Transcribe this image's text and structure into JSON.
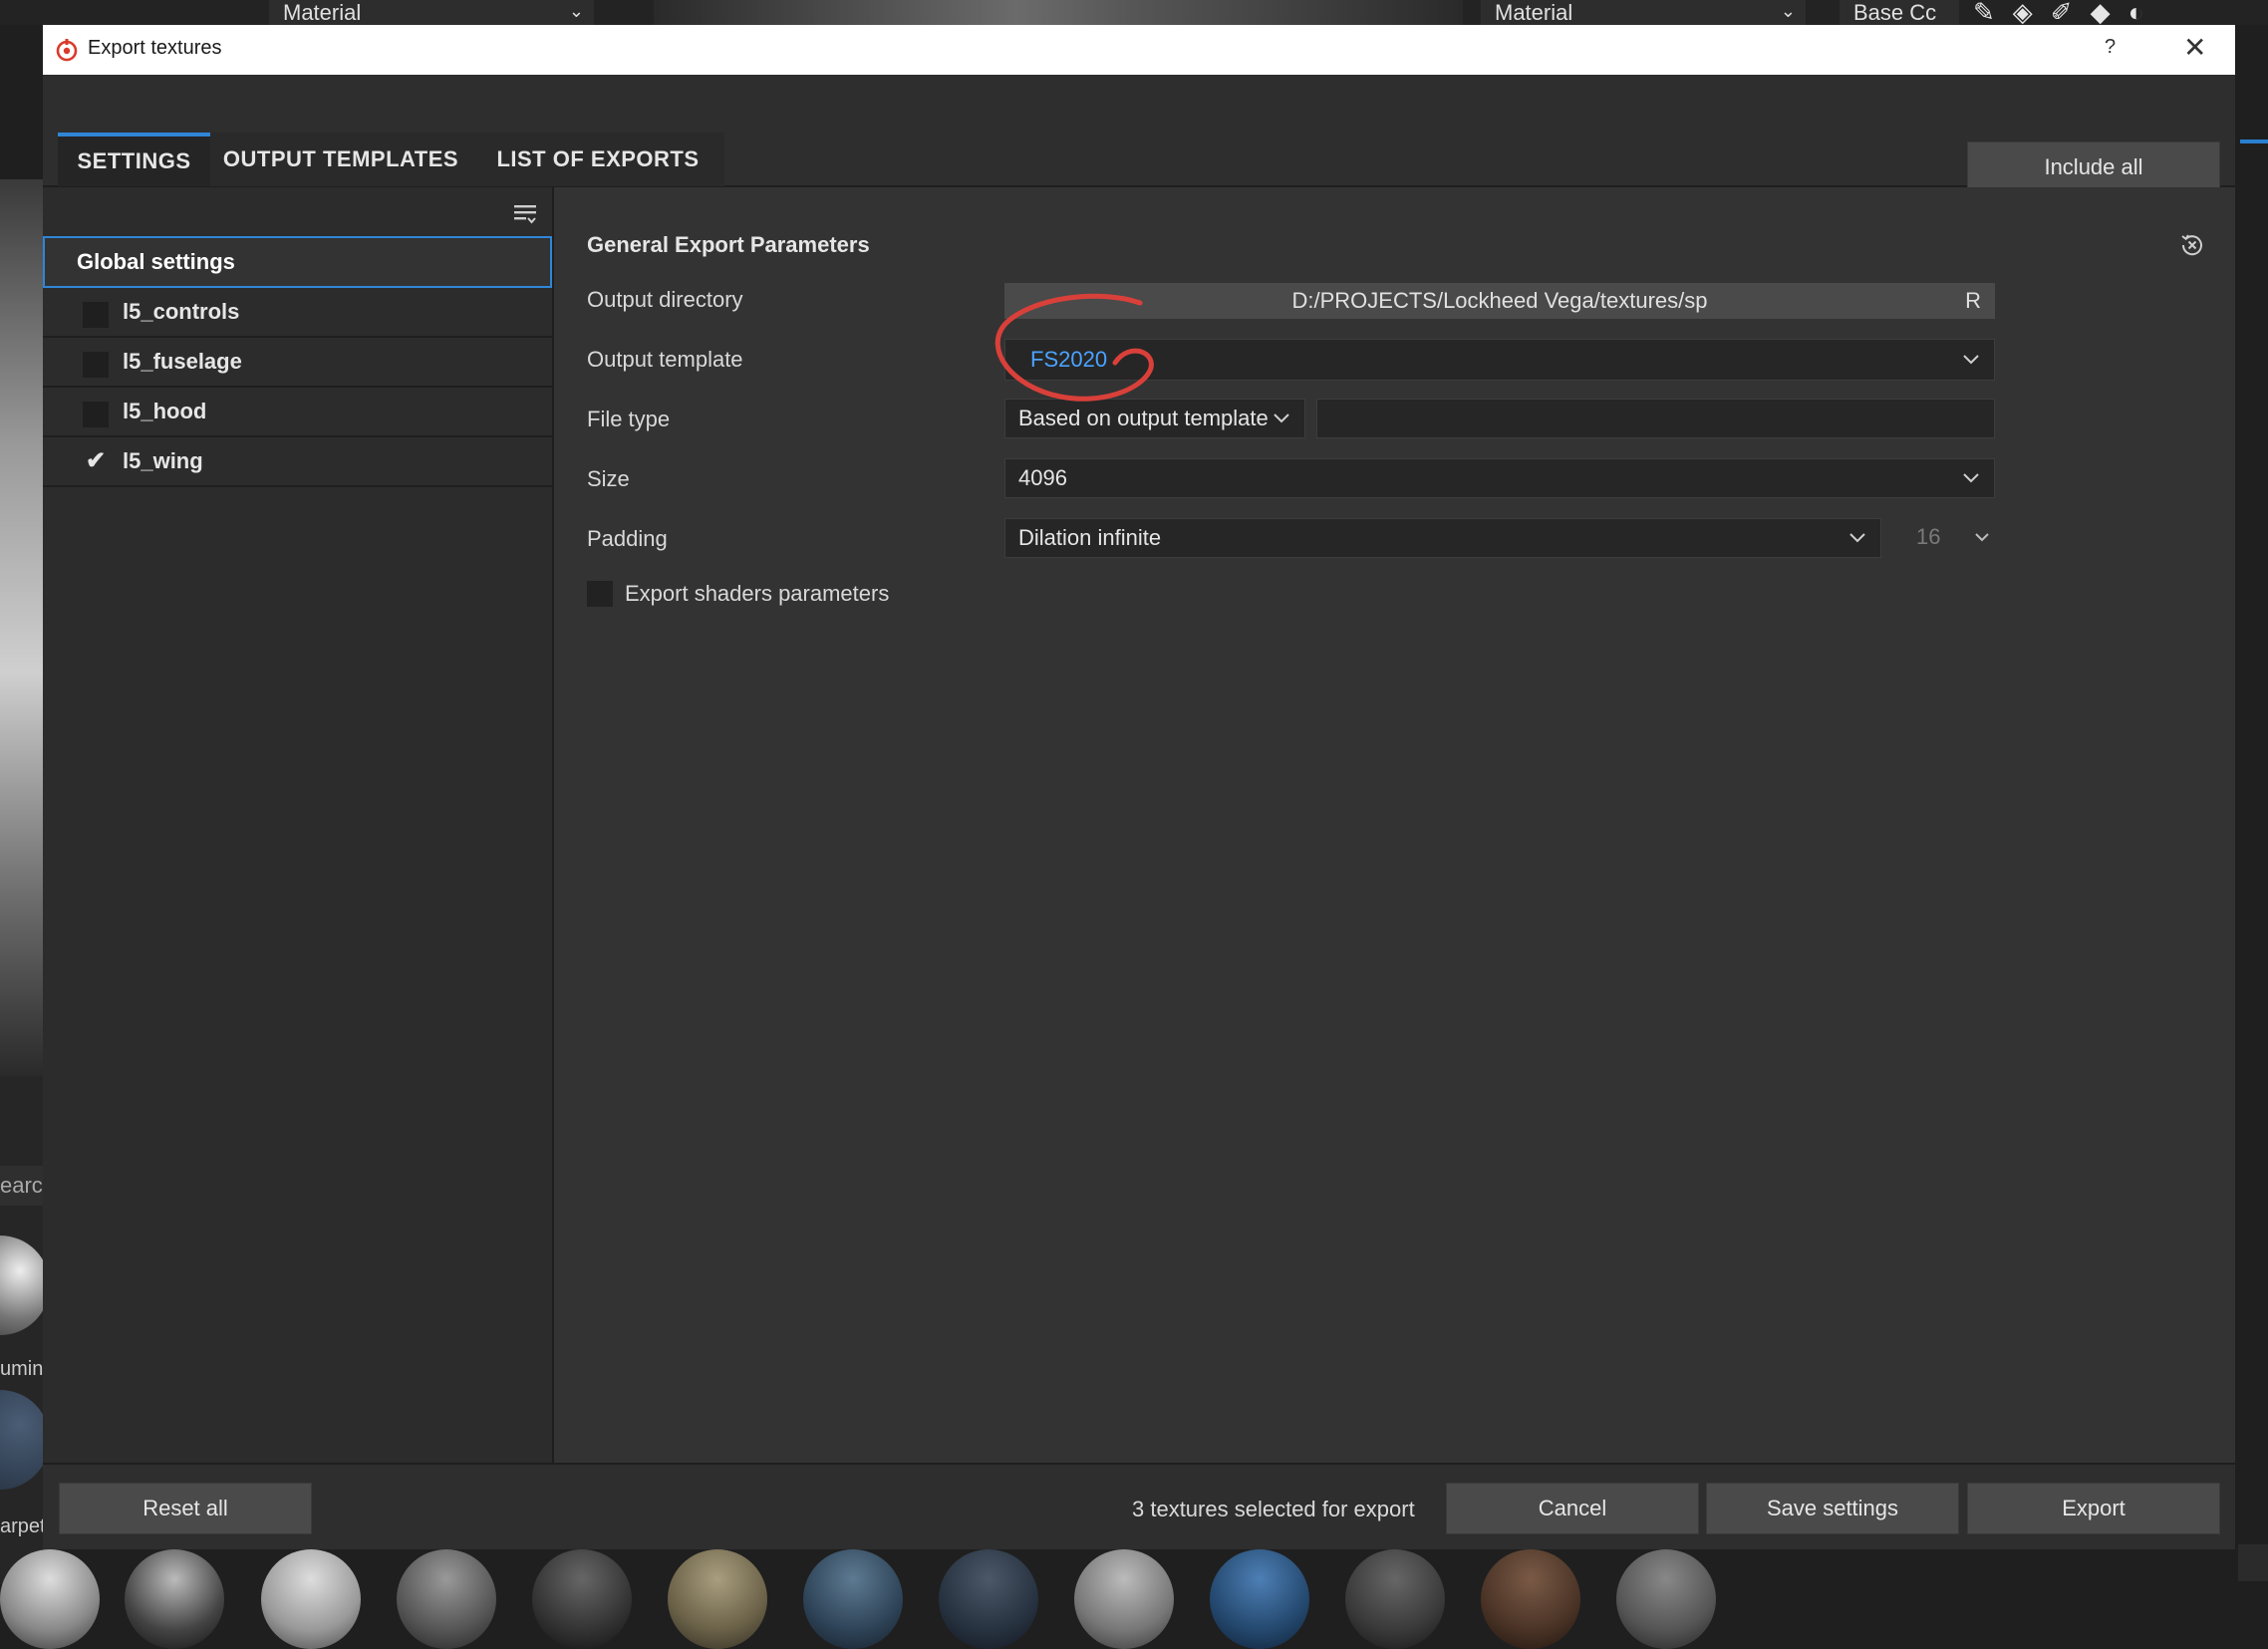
{
  "background": {
    "material_left": "Material",
    "material_right": "Material",
    "channel": "Base Cc",
    "search_fragment": "earcl",
    "shelf_label_1": "umin",
    "shelf_label_2": "arpet"
  },
  "dialog": {
    "title": "Export textures",
    "help_label": "?",
    "close_label": "✕"
  },
  "tabs": [
    {
      "label": "SETTINGS"
    },
    {
      "label": "OUTPUT TEMPLATES"
    },
    {
      "label": "LIST OF EXPORTS"
    }
  ],
  "include_all_label": "Include all",
  "sidebar": {
    "global_label": "Global settings",
    "items": [
      {
        "label": "l5_controls",
        "checked": false
      },
      {
        "label": "l5_fuselage",
        "checked": false
      },
      {
        "label": "l5_hood",
        "checked": false
      },
      {
        "label": "l5_wing",
        "checked": true
      }
    ]
  },
  "params": {
    "section_title": "General Export Parameters",
    "output_directory_label": "Output directory",
    "output_directory_value": "D:/PROJECTS/Lockheed Vega/textures/sp",
    "output_directory_suffix": "R",
    "output_template_label": "Output template",
    "output_template_value": "FS2020",
    "file_type_label": "File type",
    "file_type_value": "Based on output template",
    "size_label": "Size",
    "size_value": "4096",
    "padding_label": "Padding",
    "padding_value": "Dilation infinite",
    "padding_amount": "16",
    "export_shaders_label": "Export shaders parameters"
  },
  "footer": {
    "reset_all_label": "Reset all",
    "status_text": "3 textures selected for export",
    "cancel_label": "Cancel",
    "save_settings_label": "Save settings",
    "export_label": "Export"
  },
  "colors": {
    "accent": "#2f86d6",
    "template_text": "#4aa3ff",
    "annotation": "#d9403a"
  }
}
